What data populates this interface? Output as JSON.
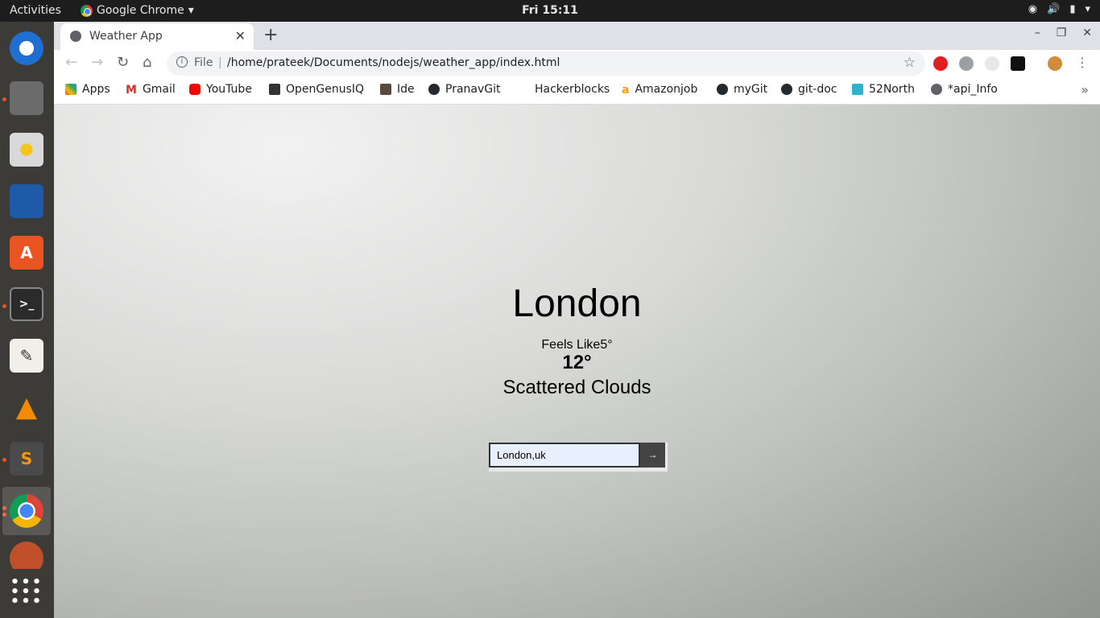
{
  "system": {
    "activities": "Activities",
    "app_name": "Google Chrome",
    "clock": "Fri 15:11"
  },
  "browser": {
    "tab_title": "Weather App",
    "omnibox_scheme": "File",
    "url": "/home/prateek/Documents/nodejs/weather_app/index.html",
    "bookmarks": [
      "Apps",
      "Gmail",
      "YouTube",
      "OpenGenusIQ",
      "Ide",
      "PranavGit",
      "Hackerblocks",
      "Amazonjob",
      "myGit",
      "git-doc",
      "52North",
      "*api_Info"
    ]
  },
  "weather": {
    "city": "London",
    "feels_like": "Feels Like5°",
    "temperature": "12°",
    "description": "Scattered Clouds"
  },
  "search": {
    "value": "London,uk",
    "submit_label": "→"
  },
  "icons": {
    "dock": [
      "thunderbird-icon",
      "files-icon",
      "rhythmbox-icon",
      "libreoffice-writer-icon",
      "software-center-icon",
      "terminal-icon",
      "text-editor-icon",
      "vlc-icon",
      "sublime-text-icon",
      "chrome-icon",
      "app-icon",
      "show-apps-icon"
    ]
  }
}
